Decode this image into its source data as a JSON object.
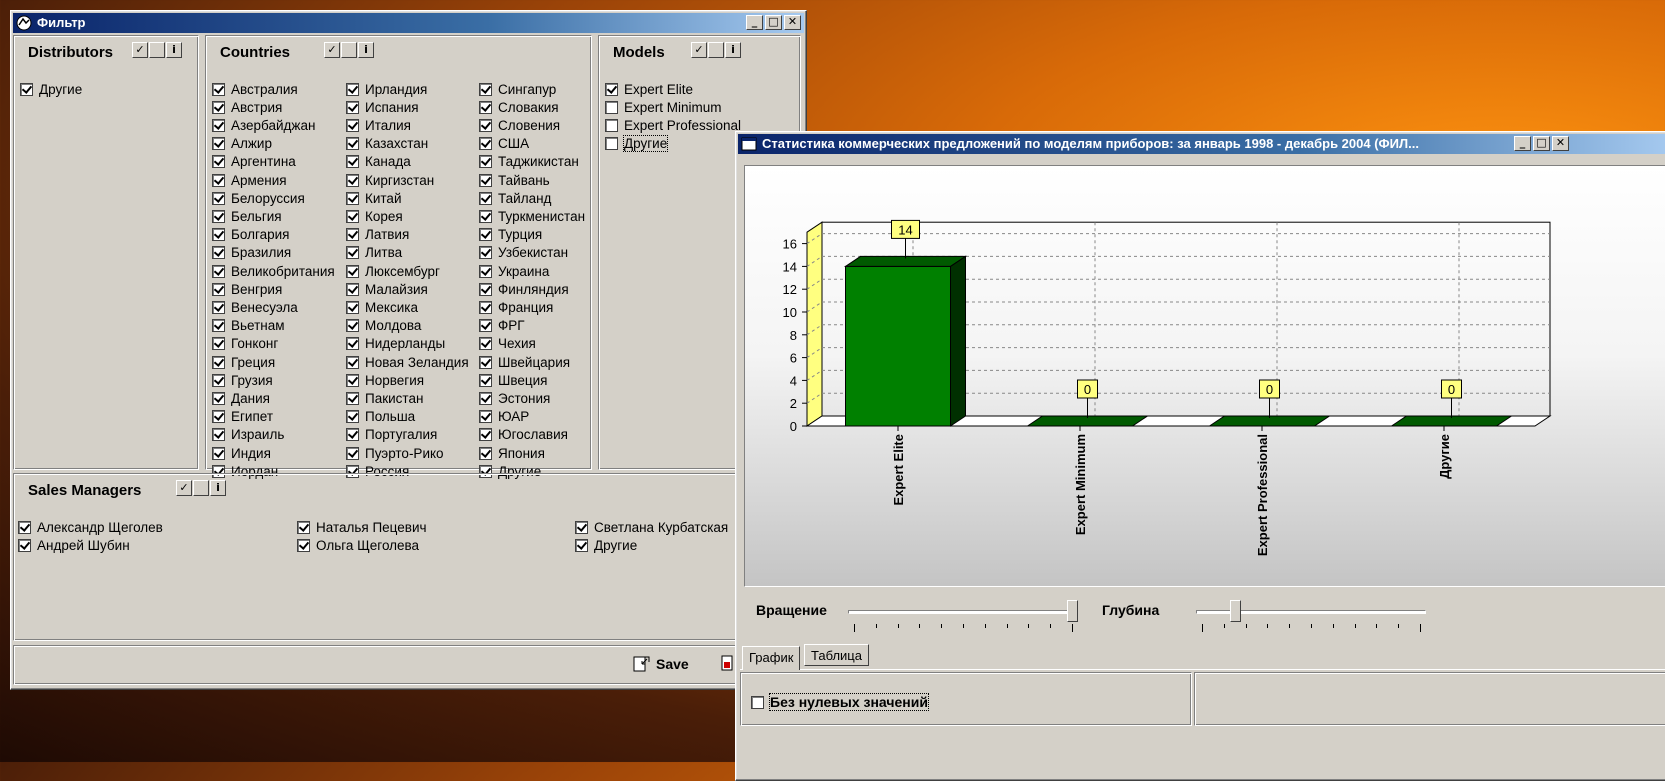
{
  "filter_window": {
    "title": "Фильтр",
    "distributors": {
      "title": "Distributors",
      "items": [
        {
          "label": "Другие",
          "checked": true
        }
      ]
    },
    "countries": {
      "title": "Countries",
      "columns": [
        [
          "Австралия",
          "Австрия",
          "Азербайджан",
          "Алжир",
          "Аргентина",
          "Армения",
          "Белоруссия",
          "Бельгия",
          "Болгария",
          "Бразилия",
          "Великобритания",
          "Венгрия",
          "Венесуэла",
          "Вьетнам",
          "Гонконг",
          "Греция",
          "Грузия",
          "Дания",
          "Египет",
          "Израиль",
          "Индия",
          "Иордан"
        ],
        [
          "Ирландия",
          "Испания",
          "Италия",
          "Казахстан",
          "Канада",
          "Киргизстан",
          "Китай",
          "Корея",
          "Латвия",
          "Литва",
          "Люксембург",
          "Малайзия",
          "Мексика",
          "Молдова",
          "Нидерланды",
          "Новая Зеландия",
          "Норвегия",
          "Пакистан",
          "Польша",
          "Португалия",
          "Пуэрто-Рико",
          "Россия"
        ],
        [
          "Сингапур",
          "Словакия",
          "Словения",
          "США",
          "Таджикистан",
          "Тайвань",
          "Тайланд",
          "Туркменистан",
          "Турция",
          "Узбекистан",
          "Украина",
          "Финляндия",
          "Франция",
          "ФРГ",
          "Чехия",
          "Швейцария",
          "Швеция",
          "Эстония",
          "ЮАР",
          "Югославия",
          "Япония",
          "Другие"
        ]
      ]
    },
    "models": {
      "title": "Models",
      "items": [
        {
          "label": "Expert Elite",
          "checked": true
        },
        {
          "label": "Expert Minimum",
          "checked": false
        },
        {
          "label": "Expert Professional",
          "checked": false
        },
        {
          "label": "Другие",
          "checked": false
        }
      ]
    },
    "sales_managers": {
      "title": "Sales Managers",
      "columns": [
        [
          "Александр Щеголев",
          "Андрей Шубин"
        ],
        [
          "Наталья Пецевич",
          "Ольга Щеголева"
        ],
        [
          "Светлана Курбатская",
          "Другие"
        ]
      ]
    },
    "save_label": "Save"
  },
  "stats_window": {
    "title": "Статистика коммерческих предложений по моделям приборов:  за январь 1998 - декабрь 2004 (ФИЛ...",
    "rotation_label": "Вращение",
    "depth_label": "Глубина",
    "rotation_value": 1.0,
    "depth_value": 0.15,
    "tabs": [
      "График",
      "Таблица"
    ],
    "active_tab": 0,
    "zero_checkbox_label": "Без нулевых значений"
  },
  "colors": {
    "bar_front": "#008000",
    "bar_top": "#005a00",
    "bar_side": "#003000",
    "label_bg": "#ffff80",
    "wall": "#ffff80"
  },
  "chart_data": {
    "type": "bar",
    "categories": [
      "Expert Elite",
      "Expert Minimum",
      "Expert Professional",
      "Другие"
    ],
    "values": [
      14,
      0,
      0,
      0
    ],
    "ylim": [
      0,
      17
    ],
    "yticks": [
      0,
      2,
      4,
      6,
      8,
      10,
      12,
      14,
      16
    ],
    "grid": true
  }
}
